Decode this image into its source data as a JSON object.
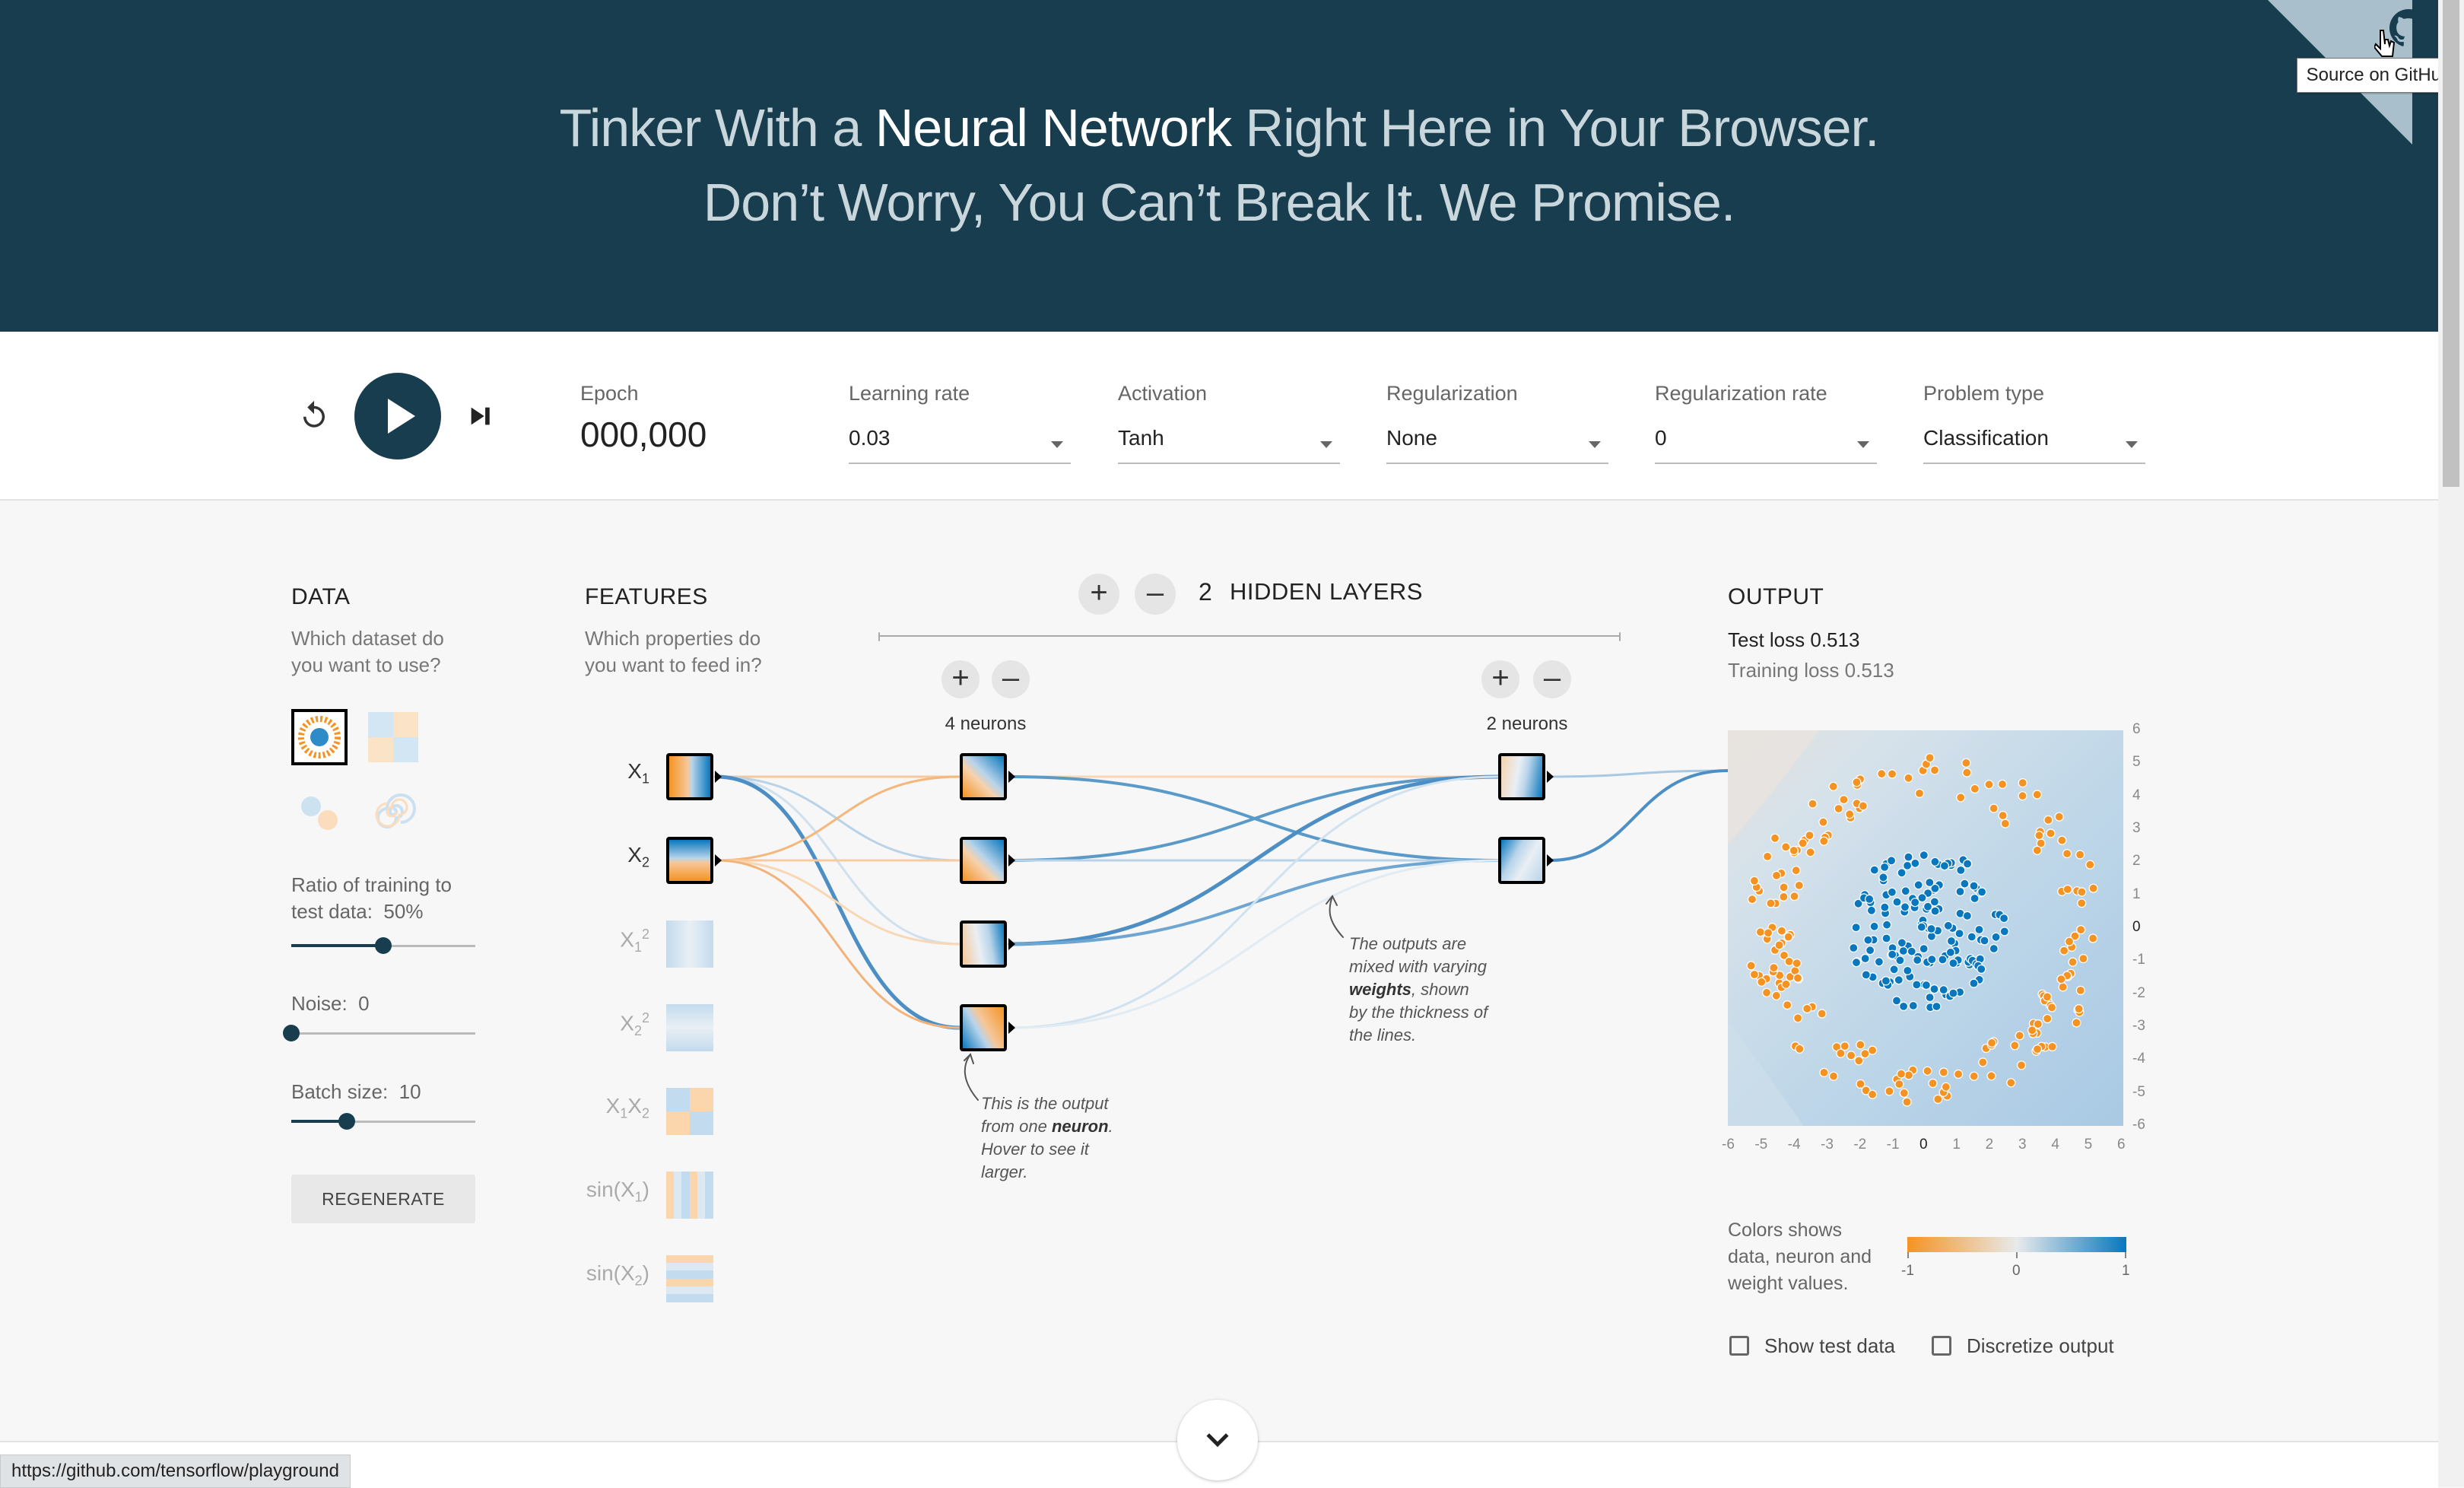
{
  "header": {
    "title_pre": "Tinker With a",
    "title_bold": "Neural Network",
    "title_post": "Right Here in Your Browser.",
    "subtitle": "Don’t Worry, You Can’t Break It. We Promise.",
    "github_tooltip": "Source on GitHub",
    "github_icon": "github-icon"
  },
  "controls": {
    "reset_icon": "reset-icon",
    "play_icon": "play-icon",
    "step_icon": "step-forward-icon",
    "epoch_label": "Epoch",
    "epoch_value": "000,000",
    "learning_rate_label": "Learning rate",
    "learning_rate_value": "0.03",
    "activation_label": "Activation",
    "activation_value": "Tanh",
    "regularization_label": "Regularization",
    "regularization_value": "None",
    "regularization_rate_label": "Regularization rate",
    "regularization_rate_value": "0",
    "problem_type_label": "Problem type",
    "problem_type_value": "Classification"
  },
  "data_panel": {
    "title": "DATA",
    "question": [
      "Which dataset do",
      "you want to use?"
    ],
    "ratio_label": "Ratio of training to",
    "ratio_label2": "test data:",
    "ratio_value": "50%",
    "ratio_level": 0.5,
    "noise_label": "Noise:",
    "noise_value": "0",
    "noise_level": 0,
    "batch_label": "Batch size:",
    "batch_value": "10",
    "batch_level": 0.3,
    "regenerate_label": "REGENERATE"
  },
  "features_panel": {
    "title": "FEATURES",
    "question": [
      "Which properties do",
      "you want to feed in?"
    ]
  },
  "network": {
    "layer_count": "2",
    "hidden_layers_label": "HIDDEN LAYERS",
    "layer1_neurons_label": "4 neurons",
    "layer2_neurons_label": "2 neurons",
    "note_neuron": [
      "This is the output",
      "from one",
      "neuron",
      ".",
      "Hover to see it",
      "larger."
    ],
    "note_weights": [
      "The outputs are",
      "mixed with varying",
      "weights",
      ", shown",
      "by the thickness of",
      "the lines."
    ]
  },
  "output_panel": {
    "title": "OUTPUT",
    "test_loss": "Test loss 0.513",
    "training_loss": "Training loss 0.513",
    "y_ticks": [
      "6",
      "5",
      "4",
      "3",
      "2",
      "1",
      "0",
      "-1",
      "-2",
      "-3",
      "-4",
      "-5",
      "-6"
    ],
    "x_ticks": [
      "-6",
      "-5",
      "-4",
      "-3",
      "-2",
      "-1",
      "0",
      "1",
      "2",
      "3",
      "4",
      "5",
      "6"
    ],
    "legend_text": [
      "Colors shows",
      "data, neuron and",
      "weight values."
    ],
    "legend_ticks": [
      "-1",
      "0",
      "1"
    ],
    "show_test_label": "Show test data",
    "discretize_label": "Discretize output",
    "colors": {
      "orange": "#f59322",
      "blue": "#0877bd",
      "light": "#e8eaeb"
    }
  },
  "status_bar_url": "https://github.com/tensorflow/playground",
  "scroll_down_icon": "chevron-down-icon"
}
